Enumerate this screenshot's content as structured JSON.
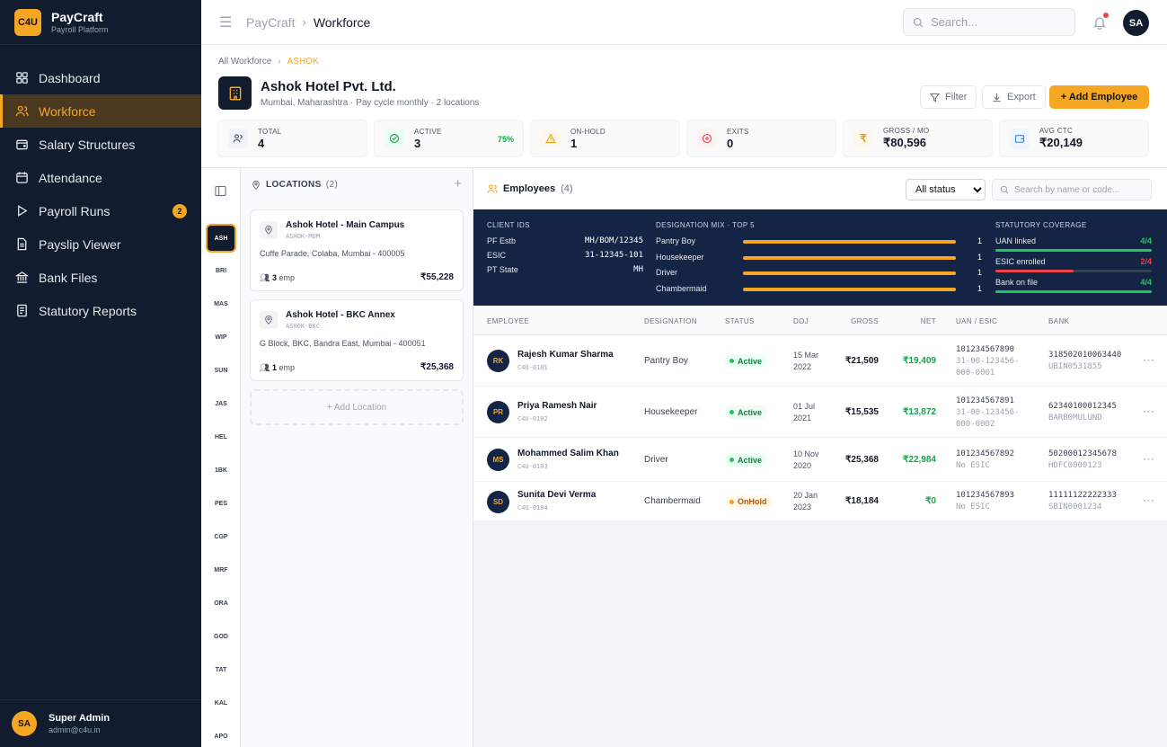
{
  "brand": {
    "logo": "C4U",
    "name": "PayCraft",
    "sub": "Payroll Platform"
  },
  "nav": [
    {
      "label": "Dashboard",
      "icon": "grid-icon"
    },
    {
      "label": "Workforce",
      "icon": "users-icon",
      "active": true
    },
    {
      "label": "Salary Structures",
      "icon": "wallet-icon"
    },
    {
      "label": "Attendance",
      "icon": "calendar-icon"
    },
    {
      "label": "Payroll Runs",
      "icon": "play-icon",
      "badge": "2"
    },
    {
      "label": "Payslip Viewer",
      "icon": "file-icon"
    },
    {
      "label": "Bank Files",
      "icon": "bank-icon"
    },
    {
      "label": "Statutory Reports",
      "icon": "report-icon"
    }
  ],
  "user": {
    "initials": "SA",
    "name": "Super Admin",
    "email": "admin@c4u.in"
  },
  "topbar": {
    "crumb_root": "PayCraft",
    "crumb_current": "Workforce",
    "search_placeholder": "Search...",
    "avatar": "SA"
  },
  "page": {
    "crumb_root": "All Workforce",
    "crumb_current": "ASHOK",
    "company": "Ashok Hotel Pvt. Ltd.",
    "company_sub": "Mumbai, Maharashtra · Pay cycle monthly · 2 locations",
    "filter": "Filter",
    "export": "Export",
    "add": "+ Add Employee"
  },
  "stats": [
    {
      "label": "TOTAL",
      "value": "4",
      "icon": "users-icon",
      "bg": "#f1f5f9",
      "fg": "#475569"
    },
    {
      "label": "ACTIVE",
      "value": "3",
      "pct": "75%",
      "icon": "check-circle-icon",
      "bg": "#ecfdf5",
      "fg": "#16a34a"
    },
    {
      "label": "ON-HOLD",
      "value": "1",
      "icon": "warning-icon",
      "bg": "#fff7ed",
      "fg": "#f59e0b"
    },
    {
      "label": "EXITS",
      "value": "0",
      "icon": "x-circle-icon",
      "bg": "#fef2f2",
      "fg": "#ef4444"
    },
    {
      "label": "GROSS / MO",
      "value": "₹80,596",
      "icon": "rupee-icon",
      "bg": "#fff7ed",
      "fg": "#f59e0b"
    },
    {
      "label": "AVG CTC",
      "value": "₹20,149",
      "icon": "wallet-icon",
      "bg": "#eff6ff",
      "fg": "#3b82f6"
    }
  ],
  "rail": [
    "ASH",
    "BRI",
    "MAS",
    "WIP",
    "SUN",
    "JAS",
    "HEL",
    "1BK",
    "PES",
    "CGP",
    "MRF",
    "ORA",
    "GOD",
    "TAT",
    "KAL",
    "APO"
  ],
  "locations": {
    "title": "LOCATIONS",
    "count": "(2)",
    "add_label": "+ Add Location",
    "items": [
      {
        "name": "Ashok Hotel - Main Campus",
        "code": "ASHOK-MUM",
        "address": "Cuffe Parade, Colaba, Mumbai - 400005",
        "emp_count": "3",
        "emp_label": "emp",
        "amount": "₹55,228"
      },
      {
        "name": "Ashok Hotel - BKC Annex",
        "code": "ASHOK-BKC",
        "address": "G Block, BKC, Bandra East, Mumbai - 400051",
        "emp_count": "1",
        "emp_label": "emp",
        "amount": "₹25,368"
      }
    ]
  },
  "employees_panel": {
    "title": "Employees",
    "count": "(4)",
    "status_filter": "All status",
    "search_placeholder": "Search by name or code..."
  },
  "client_ids": {
    "title": "CLIENT IDS",
    "rows": [
      {
        "label": "PF Estb",
        "value": "MH/BOM/12345"
      },
      {
        "label": "ESIC",
        "value": "31-12345-101"
      },
      {
        "label": "PT State",
        "value": "MH"
      }
    ]
  },
  "designation_mix": {
    "title": "DESIGNATION MIX · TOP 5",
    "rows": [
      {
        "label": "Pantry Boy",
        "count": "1",
        "share": 1
      },
      {
        "label": "Housekeeper",
        "count": "1",
        "share": 1
      },
      {
        "label": "Driver",
        "count": "1",
        "share": 1
      },
      {
        "label": "Chambermaid",
        "count": "1",
        "share": 1
      }
    ]
  },
  "coverage": {
    "title": "STATUTORY COVERAGE",
    "rows": [
      {
        "label": "UAN linked",
        "frac": "4/4",
        "ratio": 1,
        "color": "#22c55e"
      },
      {
        "label": "ESIC enrolled",
        "frac": "2/4",
        "ratio": 0.5,
        "color": "#ef4444"
      },
      {
        "label": "Bank on file",
        "frac": "4/4",
        "ratio": 1,
        "color": "#22c55e"
      }
    ]
  },
  "table": {
    "headers": [
      "EMPLOYEE",
      "DESIGNATION",
      "STATUS",
      "DOJ",
      "GROSS",
      "NET",
      "UAN / ESIC",
      "BANK"
    ],
    "rows": [
      {
        "initials": "RK",
        "name": "Rajesh Kumar Sharma",
        "code": "C4U-0101",
        "designation": "Pantry Boy",
        "status": "Active",
        "doj1": "15 Mar",
        "doj2": "2022",
        "gross": "₹21,509",
        "net": "₹19,409",
        "uan": "101234567890",
        "esic1": "31-00-123456-",
        "esic2": "000-0001",
        "bank": "318502010063440",
        "ifsc": "UBIN0531855"
      },
      {
        "initials": "PR",
        "name": "Priya Ramesh Nair",
        "code": "C4U-0102",
        "designation": "Housekeeper",
        "status": "Active",
        "doj1": "01 Jul",
        "doj2": "2021",
        "gross": "₹15,535",
        "net": "₹13,872",
        "uan": "101234567891",
        "esic1": "31-00-123456-",
        "esic2": "000-0002",
        "bank": "62340100012345",
        "ifsc": "BARB0MULUND"
      },
      {
        "initials": "MS",
        "name": "Mohammed Salim Khan",
        "code": "C4U-0103",
        "designation": "Driver",
        "status": "Active",
        "doj1": "10 Nov",
        "doj2": "2020",
        "gross": "₹25,368",
        "net": "₹22,984",
        "uan": "101234567892",
        "esic1": "No ESIC",
        "esic2": "",
        "bank": "50200012345678",
        "ifsc": "HDFC0000123"
      },
      {
        "initials": "SD",
        "name": "Sunita Devi Verma",
        "code": "C4U-0104",
        "designation": "Chambermaid",
        "status": "OnHold",
        "doj1": "20 Jan",
        "doj2": "2023",
        "gross": "₹18,184",
        "net": "₹0",
        "uan": "101234567893",
        "esic1": "No ESIC",
        "esic2": "",
        "bank": "11111122222333",
        "ifsc": "SBIN0001234"
      }
    ]
  }
}
